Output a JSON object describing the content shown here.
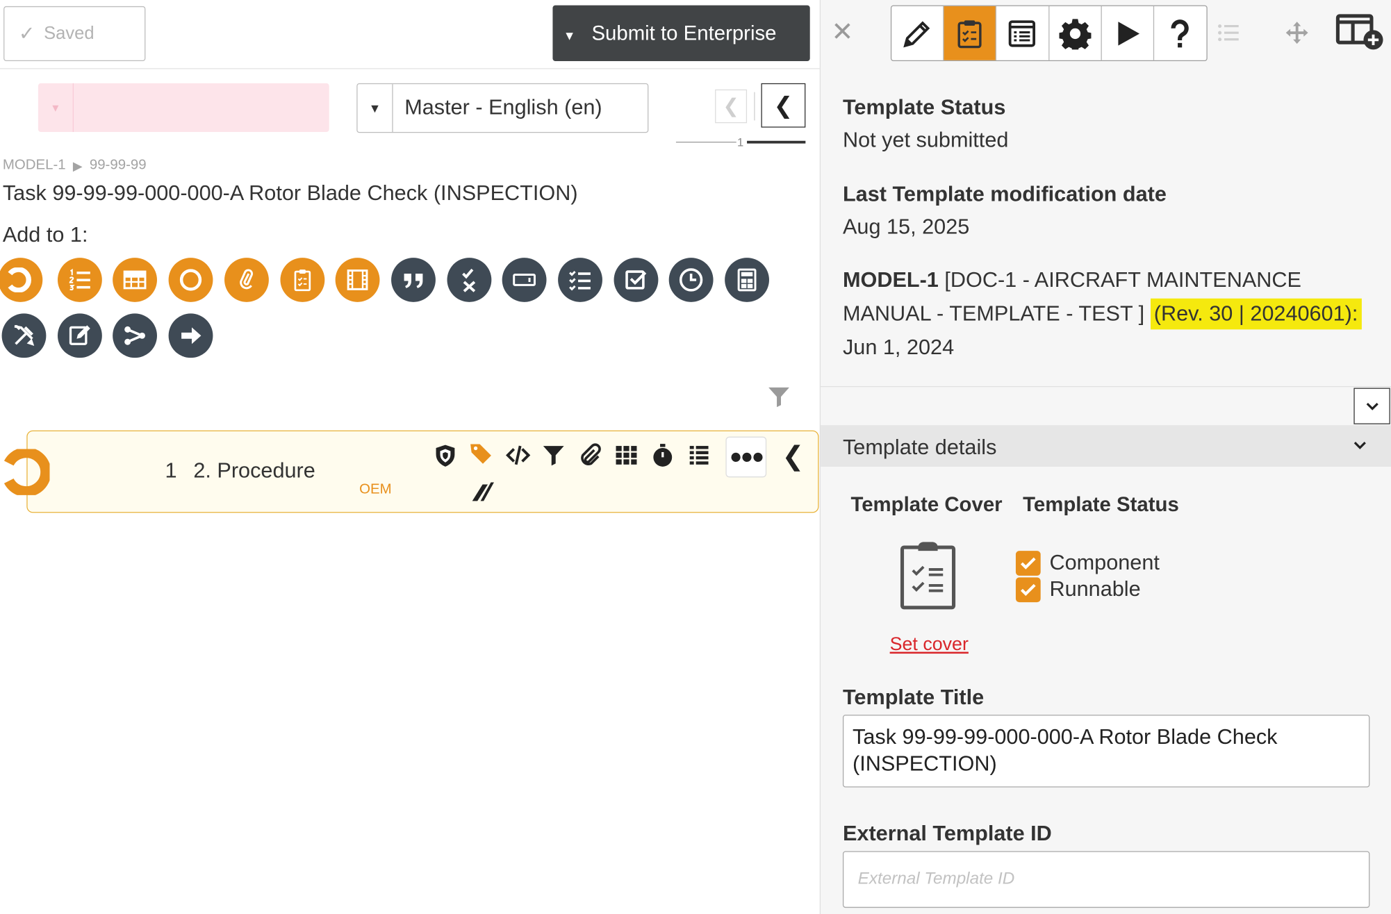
{
  "top": {
    "saved_label": "Saved",
    "submit_label": "Submit to Enterprise"
  },
  "editor": {
    "language": "Master - English (en)",
    "page_number": "1",
    "breadcrumb": [
      "MODEL-1",
      "99-99-99"
    ],
    "task_title": "Task 99-99-99-000-000-A Rotor Blade Check (INSPECTION)",
    "add_to_label": "Add to 1:",
    "add_icons_row1": [
      {
        "name": "step-ring-icon",
        "color": "orange"
      },
      {
        "name": "numbered-list-icon",
        "color": "orange"
      },
      {
        "name": "table-icon",
        "color": "orange"
      },
      {
        "name": "circle-icon",
        "color": "orange"
      },
      {
        "name": "attachment-icon",
        "color": "orange"
      },
      {
        "name": "clipboard-checklist-icon",
        "color": "orange"
      },
      {
        "name": "film-icon",
        "color": "orange"
      },
      {
        "name": "quote-icon",
        "color": "dark"
      },
      {
        "name": "check-x-icon",
        "color": "dark"
      },
      {
        "name": "input-field-icon",
        "color": "dark"
      },
      {
        "name": "checklist-icon",
        "color": "dark"
      },
      {
        "name": "checkbox-icon",
        "color": "dark"
      },
      {
        "name": "clock-icon",
        "color": "dark"
      },
      {
        "name": "calculator-icon",
        "color": "dark"
      }
    ],
    "add_icons_row2": [
      {
        "name": "tools-icon",
        "color": "dark"
      },
      {
        "name": "edit-signoff-icon",
        "color": "dark"
      },
      {
        "name": "share-branch-icon",
        "color": "dark"
      },
      {
        "name": "arrow-right-icon",
        "color": "dark"
      }
    ],
    "procedure": {
      "number": "1",
      "title": "2. Procedure",
      "source": "OEM"
    }
  },
  "sidebar": {
    "status_label": "Template Status",
    "status_value": "Not yet submitted",
    "mod_date_label": "Last Template modification date",
    "mod_date_value": "Aug 15, 2025",
    "model_name": "MODEL-1",
    "doc_text": "[DOC-1 - AIRCRAFT MAINTENANCE MANUAL - TEMPLATE - TEST ]",
    "revision": "(Rev. 30 | 20240601):",
    "revision_date": "Jun 1, 2024",
    "details_title": "Template details",
    "cover_label": "Template Cover",
    "status_section_label": "Template Status",
    "flags": [
      "Component",
      "Runnable"
    ],
    "set_cover": "Set cover",
    "title_label": "Template Title",
    "title_value": "Task 99-99-99-000-000-A Rotor Blade Check (INSPECTION)",
    "ext_id_label": "External Template ID",
    "ext_id_placeholder": "External Template ID",
    "ext_id_value": ""
  },
  "colors": {
    "accent": "#e8901c",
    "dark_icon": "#3f4a55",
    "highlight": "#f5e90e",
    "link_red": "#d9262b"
  }
}
